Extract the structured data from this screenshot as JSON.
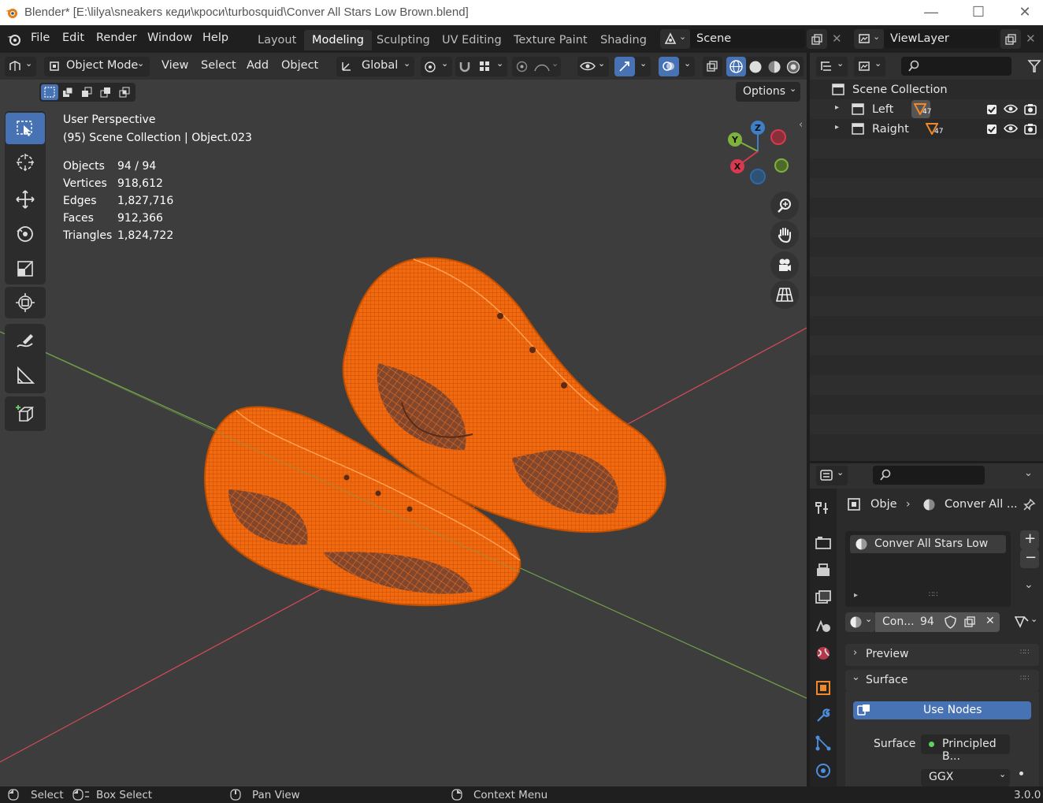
{
  "window": {
    "title": "Blender* [E:\\lilya\\sneakers кеди\\кроси\\turbosquid\\Conver All Stars Low  Brown.blend]",
    "minimize": "—",
    "maximize": "☐",
    "close": "✕"
  },
  "menu": [
    "File",
    "Edit",
    "Render",
    "Window",
    "Help"
  ],
  "workspaces": [
    "Layout",
    "Modeling",
    "Sculpting",
    "UV Editing",
    "Texture Paint",
    "Shading"
  ],
  "active_workspace": "Modeling",
  "scene": {
    "name": "Scene"
  },
  "view_layer": {
    "name": "ViewLayer"
  },
  "viewport_header": {
    "mode": "Object Mode",
    "menus": [
      "View",
      "Select",
      "Add",
      "Object"
    ],
    "transform_orientation": "Global",
    "options_label": "Options"
  },
  "viewport": {
    "perspective": "User Perspective",
    "context": "(95) Scene Collection | Object.023",
    "stats": [
      {
        "label": "Objects",
        "value": "94 / 94"
      },
      {
        "label": "Vertices",
        "value": "918,612"
      },
      {
        "label": "Edges",
        "value": "1,827,716"
      },
      {
        "label": "Faces",
        "value": "912,366"
      },
      {
        "label": "Triangles",
        "value": "1,824,722"
      }
    ],
    "gizmo": {
      "x": "X",
      "y": "Y",
      "z": "Z"
    },
    "colors": {
      "background": "#3d3d3d",
      "selection": "#ff6a00",
      "x_axis": "#d94a5a",
      "y_axis": "#74a34a"
    }
  },
  "outliner": {
    "root": "Scene Collection",
    "items": [
      {
        "name": "Left",
        "badge": "47"
      },
      {
        "name": "Raight",
        "badge": "47"
      }
    ]
  },
  "properties": {
    "breadcrumb_object": "Obje",
    "breadcrumb_material": "Conver All ...",
    "material_slot": "Conver All Stars Low",
    "material_name_short": "Con...",
    "user_count": "94",
    "panels": {
      "preview": "Preview",
      "surface": "Surface"
    },
    "use_nodes": "Use Nodes",
    "surface_label": "Surface",
    "surface_value": "Principled B...",
    "distribution": "GGX"
  },
  "statusbar": {
    "select": "Select",
    "box_select": "Box Select",
    "pan_view": "Pan View",
    "context_menu": "Context Menu",
    "version": "3.0.0"
  }
}
